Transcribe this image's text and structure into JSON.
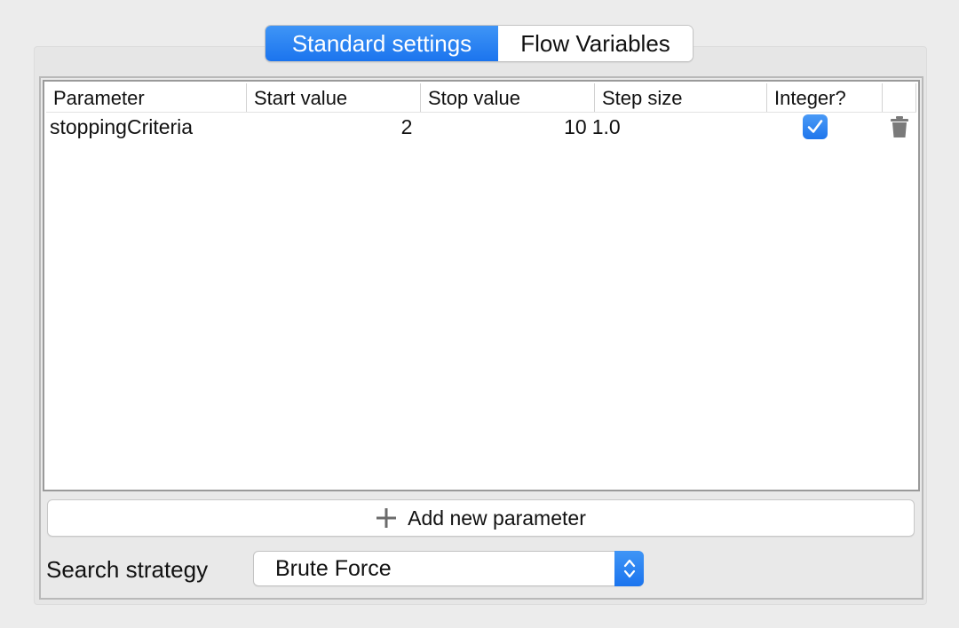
{
  "tabs": [
    {
      "label": "Standard settings",
      "active": true
    },
    {
      "label": "Flow Variables",
      "active": false
    }
  ],
  "table": {
    "columns": [
      "Parameter",
      "Start value",
      "Stop value",
      "Step size",
      "Integer?",
      ""
    ],
    "rows": [
      {
        "parameter": "stoppingCriteria",
        "start_value": "2",
        "stop_value": "10",
        "step_size": "1.0",
        "integer": true,
        "delete_icon": "trash-icon"
      }
    ]
  },
  "add_button": {
    "label": "Add new parameter",
    "icon": "plus-icon"
  },
  "search_strategy": {
    "label": "Search strategy",
    "value": "Brute Force",
    "icon": "up-down-chevron-icon"
  },
  "colors": {
    "accent": "#1f76ec",
    "background": "#ececec"
  }
}
